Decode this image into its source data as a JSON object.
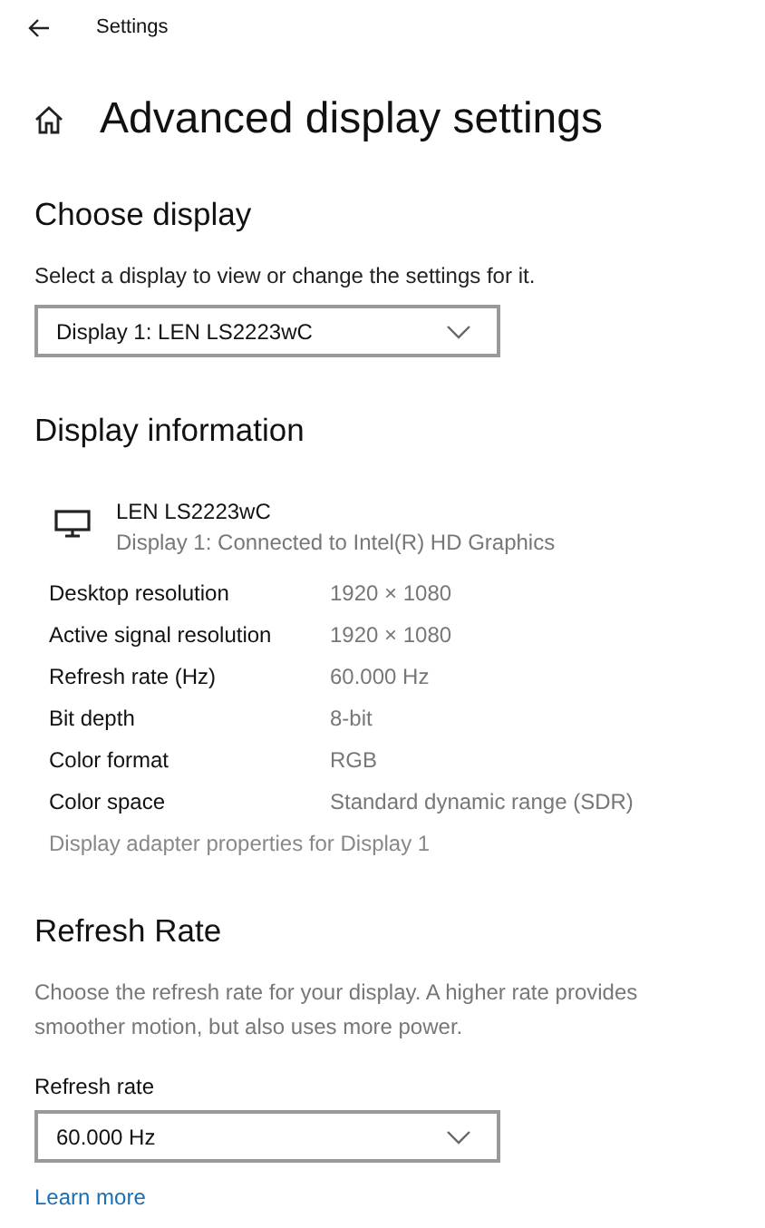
{
  "window": {
    "title": "Settings"
  },
  "page_title": "Advanced display settings",
  "choose_display": {
    "heading": "Choose display",
    "description": "Select a display to view or change the settings for it.",
    "dropdown": {
      "value": "Display 1: LEN LS2223wC"
    }
  },
  "display_information": {
    "heading": "Display information",
    "monitor": {
      "name": "LEN LS2223wC",
      "connection": "Display 1: Connected to Intel(R) HD Graphics"
    },
    "rows": [
      {
        "label": "Desktop resolution",
        "value": "1920 × 1080"
      },
      {
        "label": "Active signal resolution",
        "value": "1920 × 1080"
      },
      {
        "label": "Refresh rate (Hz)",
        "value": "60.000 Hz"
      },
      {
        "label": "Bit depth",
        "value": "8-bit"
      },
      {
        "label": "Color format",
        "value": "RGB"
      },
      {
        "label": "Color space",
        "value": "Standard dynamic range (SDR)"
      }
    ],
    "adapter_link": "Display adapter properties for Display 1"
  },
  "refresh_rate": {
    "heading": "Refresh Rate",
    "description": "Choose the refresh rate for your display. A higher rate provides smoother motion, but also uses more power.",
    "label": "Refresh rate",
    "dropdown": {
      "value": "60.000 Hz"
    },
    "learn_more": "Learn more"
  }
}
